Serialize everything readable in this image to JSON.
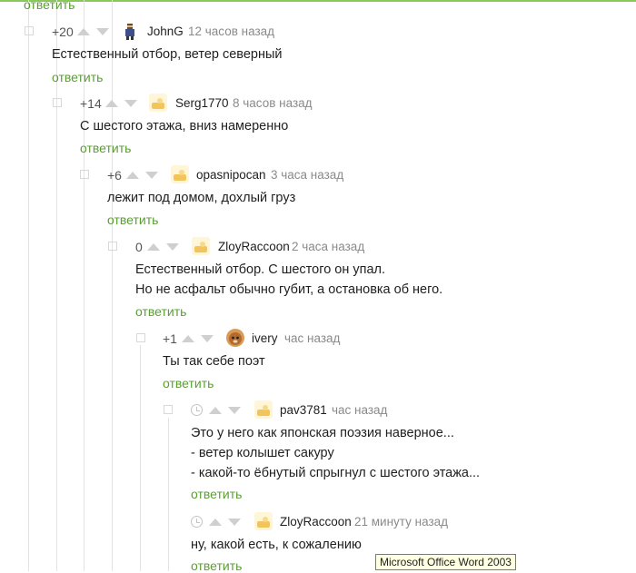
{
  "top_reply": "ответить",
  "comments": [
    {
      "rating": "+20",
      "author": "JohnG",
      "time": "12 часов назад",
      "lines": [
        "Естественный отбор, ветер северный"
      ],
      "reply": "ответить"
    },
    {
      "rating": "+14",
      "author": "Serg1770",
      "time": "8 часов назад",
      "lines": [
        "С шестого этажа, вниз намеренно"
      ],
      "reply": "ответить"
    },
    {
      "rating": "+6",
      "author": "opasnipocan",
      "time": "3 часа назад",
      "lines": [
        "лежит под домом, дохлый груз"
      ],
      "reply": "ответить"
    },
    {
      "rating": "0",
      "author": "ZloyRaccoon",
      "time": "2 часа назад",
      "lines": [
        "Естественный отбор. С шестого он упал.",
        "Но не асфальт обычно губит, а остановка об него."
      ],
      "reply": "ответить"
    },
    {
      "rating": "+1",
      "author": "ivery",
      "time": "час назад",
      "lines": [
        "Ты так себе поэт"
      ],
      "reply": "ответить"
    },
    {
      "rating": "",
      "author": "pav3781",
      "time": "час назад",
      "lines": [
        "Это у него как японская поэзия наверное...",
        "- ветер колышет сакуру",
        "- какой-то ёбнутый спрыгнул с шестого этажа..."
      ],
      "reply": "ответить"
    },
    {
      "rating": "",
      "author": "ZloyRaccoon",
      "time": "21 минуту назад",
      "lines": [
        "ну, какой есть, к сожалению"
      ],
      "reply": "ответить"
    }
  ],
  "tooltip": "Microsoft Office Word 2003",
  "colors": {
    "accent": "#5a9e33",
    "top_border": "#8ac858",
    "thread_line": "#e3e3e3"
  }
}
